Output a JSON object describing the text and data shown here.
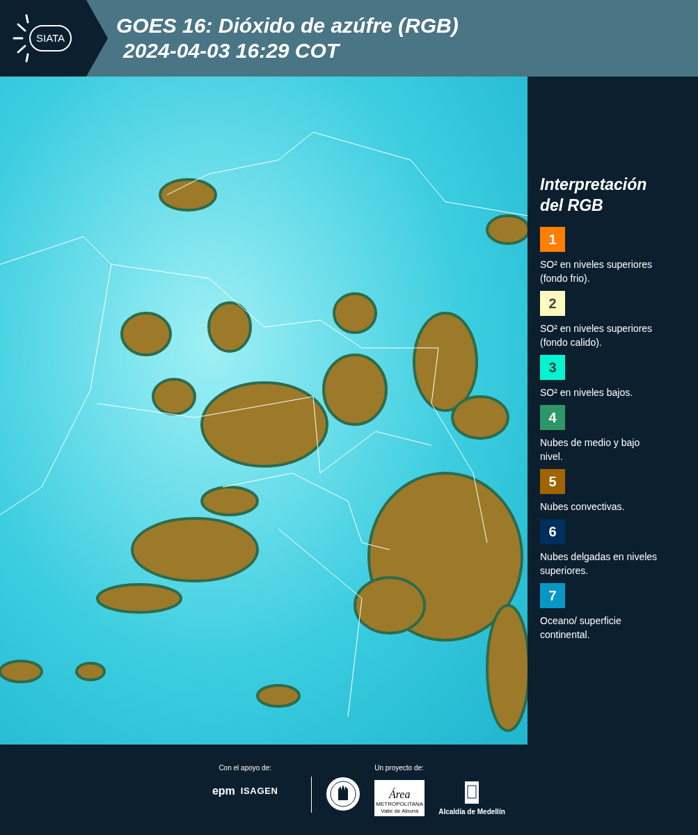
{
  "header": {
    "logo_text": "SIATA",
    "title": "GOES 16: Dióxido de azúfre (RGB)",
    "subtitle": "2024-04-03 16:29 COT"
  },
  "legend": {
    "title": "Interpretación del RGB",
    "items": [
      {
        "number": "1",
        "color": "#ff7f00",
        "text": "SO² en niveles superiores (fondo frio)."
      },
      {
        "number": "2",
        "color": "#fff9c0",
        "text": "SO² en niveles superiores (fondo calido)."
      },
      {
        "number": "3",
        "color": "#00f5d0",
        "text": "SO² en niveles bajos."
      },
      {
        "number": "4",
        "color": "#2e9767",
        "text": "Nubes de medio y bajo nivel."
      },
      {
        "number": "5",
        "color": "#a06400",
        "text": "Nubes convectivas."
      },
      {
        "number": "6",
        "color": "#002e5d",
        "text": "Nubes delgadas en niveles superiores."
      },
      {
        "number": "7",
        "color": "#0796c6",
        "text": "Oceano/ superficie continental."
      }
    ]
  },
  "footer": {
    "support_label": "Con el apoyo de:",
    "sponsors": [
      "epm",
      "ISAGEN"
    ],
    "project_label": "Un proyecto de:",
    "area_logo": {
      "name": "Área",
      "line1": "METROPOLITANA",
      "line2": "Valle de Aburrá"
    },
    "alcaldia": "Alcaldía de Medellín"
  }
}
